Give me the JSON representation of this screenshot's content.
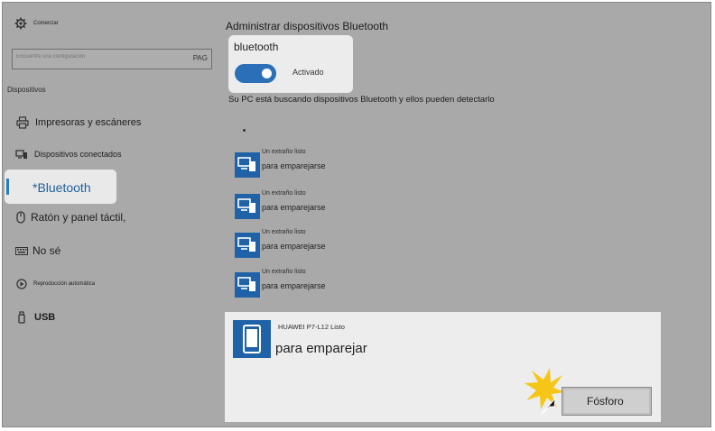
{
  "sidebar": {
    "home_label": "Comenzar",
    "search_placeholder": "Encuentre una configuración",
    "search_suffix": "PAG",
    "section_label": "Dispositivos",
    "items": [
      {
        "label": "Impresoras y escáneres",
        "icon": "printer-icon"
      },
      {
        "label": "Dispositivos conectados",
        "icon": "connected-devices-icon"
      },
      {
        "label": "*Bluetooth",
        "icon": "",
        "selected": true
      },
      {
        "label": "Ratón y panel táctil,",
        "icon": "mouse-icon"
      },
      {
        "label": "No sé",
        "icon": "keyboard-icon"
      },
      {
        "label": "Reproducción automática",
        "icon": "autoplay-icon"
      },
      {
        "label": "USB",
        "icon": "usb-icon"
      }
    ]
  },
  "main": {
    "title": "Administrar dispositivos Bluetooth",
    "bluetooth_label": "bluetooth",
    "toggle_state": "Activado",
    "scan_text": "Su PC está buscando dispositivos Bluetooth y ellos pueden detectarlo",
    "devices": [
      {
        "name": "Un extraño listo",
        "status": "para emparejarse"
      },
      {
        "name": "Un extraño listo",
        "status": "para emparejarse"
      },
      {
        "name": "Un extraño listo",
        "status": "para emparejarse"
      },
      {
        "name": "Un extraño listo",
        "status": "para emparejarse"
      }
    ],
    "selected_device": {
      "name": "HUAWEI P7-L12 Listo",
      "status": "para emparejar",
      "button_label": "Fósforo"
    }
  },
  "colors": {
    "background": "#a9a9a9",
    "accent": "#1f62a8",
    "panel": "#ececec",
    "highlight": "#f5c518"
  }
}
